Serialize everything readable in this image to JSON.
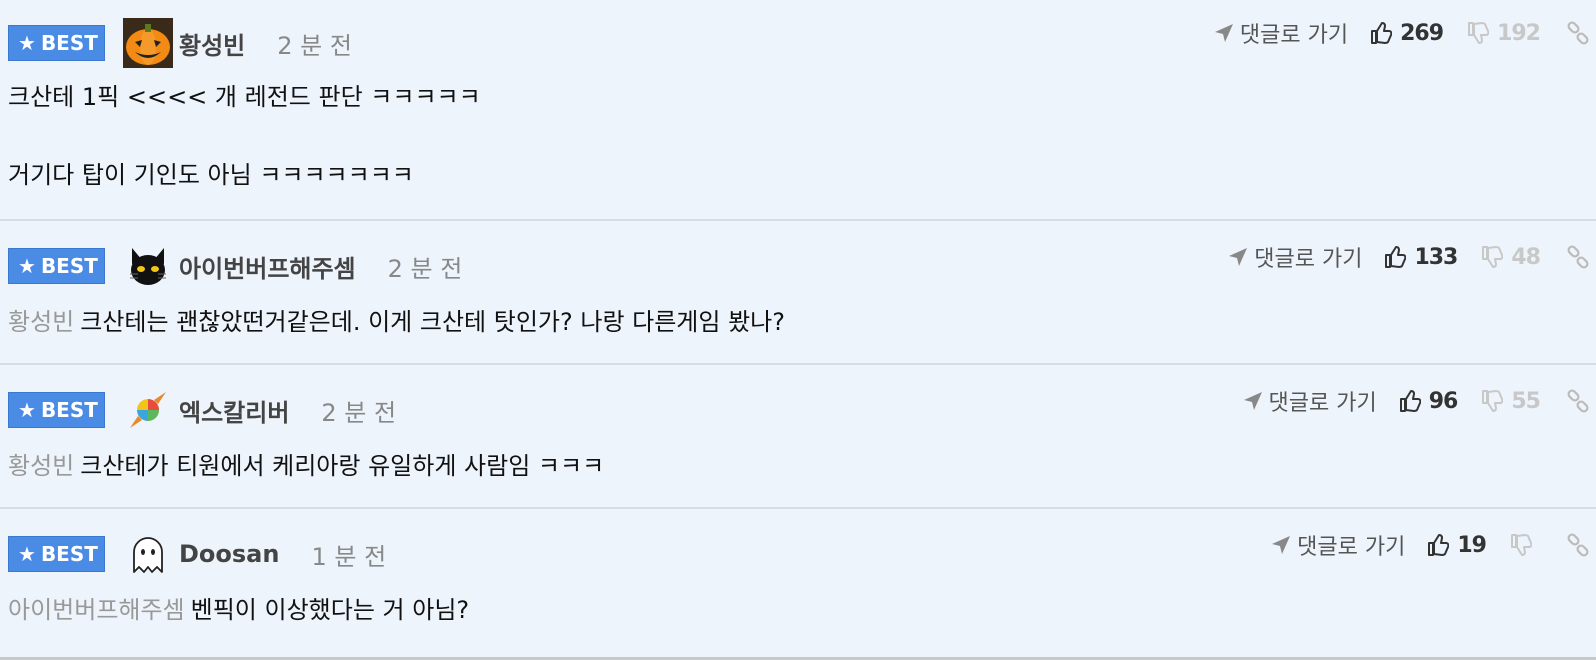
{
  "goto_label": "댓글로 가기",
  "best_label": "BEST",
  "comments": [
    {
      "nick": "황성빈",
      "time": "2 분 전",
      "avatar": "pumpkin-avatar",
      "line1": "크산테 1픽 <<<< 개 레전드 판단 ㅋㅋㅋㅋㅋ",
      "line2": "거기다 탑이 기인도 아님 ㅋㅋㅋㅋㅋㅋㅋ",
      "likes": "269",
      "dislikes": "192"
    },
    {
      "nick": "아이번버프해주셈",
      "time": "2 분 전",
      "avatar": "black-cat-avatar",
      "mention": "황성빈",
      "text": "크산테는 괜찮았떤거같은데. 이게 크산테 탓인가? 나랑 다른게임 봤나?",
      "likes": "133",
      "dislikes": "48"
    },
    {
      "nick": "엑스칼리버",
      "time": "2 분 전",
      "avatar": "candy-avatar",
      "mention": "황성빈",
      "text": "크산테가 티원에서 케리아랑 유일하게 사람임 ㅋㅋㅋ",
      "likes": "96",
      "dislikes": "55"
    },
    {
      "nick": "Doosan",
      "time": "1 분 전",
      "avatar": "ghost-avatar",
      "mention": "아이번버프해주셈",
      "text": "벤픽이 이상했다는 거 아님?",
      "likes": "19",
      "dislikes": ""
    }
  ],
  "colors": {
    "best_bg": "#4a8be6",
    "background": "#eef4fc",
    "mention": "#999999"
  }
}
